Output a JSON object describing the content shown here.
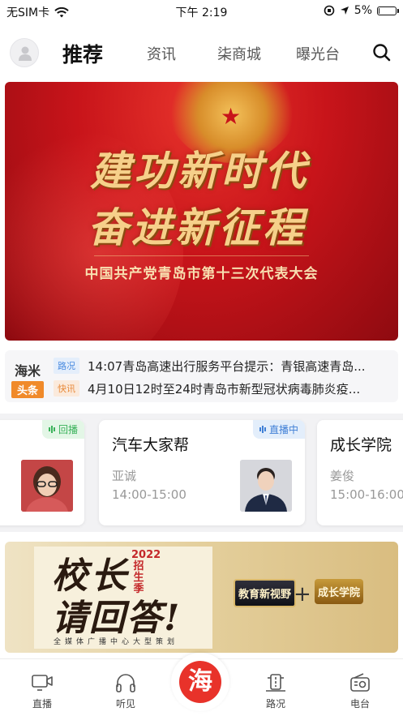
{
  "status_bar": {
    "carrier": "无SIM卡",
    "time": "下午 2:19",
    "battery": "5%",
    "battery_level": 0.05
  },
  "header": {
    "tabs": [
      {
        "label": "推荐",
        "active": true
      },
      {
        "label": "资讯",
        "active": false
      },
      {
        "label": "柒商城",
        "active": false
      },
      {
        "label": "曝光台",
        "active": false
      }
    ],
    "icons": [
      "avatar-icon",
      "search-icon"
    ]
  },
  "banner": {
    "headline_1": "建功新时代",
    "headline_2": "奋进新征程",
    "subtitle": "中国共产党青岛市第十三次代表大会"
  },
  "news": {
    "logo_top": "海米",
    "logo_bottom": "头条",
    "items": [
      {
        "tag": "路况",
        "text": "14:07青岛高速出行服务平台提示：青银高速青岛..."
      },
      {
        "tag": "快讯",
        "text": "4月10日12时至24时青岛市新型冠状病毒肺炎疫..."
      }
    ]
  },
  "programs": [
    {
      "badge": "回播",
      "title": "",
      "host": "",
      "time": ""
    },
    {
      "badge": "直播中",
      "title": "汽车大家帮",
      "host": "亚诚",
      "time": "14:00-15:00"
    },
    {
      "badge": "",
      "title": "成长学院",
      "host": "姜俊",
      "time": "15:00-16:00"
    }
  ],
  "promo": {
    "headline_1": "校长",
    "headline_2": "请回答!",
    "year_label": "2022招生季",
    "footer": "全媒体广播中心大型策划",
    "badge_left": "教育新视野",
    "badge_right": "成长学院",
    "plus": "+"
  },
  "bottom_nav": {
    "items": [
      {
        "label": "直播",
        "icon": "live-video-icon"
      },
      {
        "label": "听见",
        "icon": "headphones-icon"
      },
      {
        "label": "路况",
        "icon": "traffic-icon"
      },
      {
        "label": "电台",
        "icon": "radio-icon"
      }
    ],
    "center": "海"
  },
  "colors": {
    "accent": "#e8322a",
    "tab_underline": "#f2a23a",
    "live_badge": "#3f7fd6",
    "replay_badge": "#3ab25a"
  }
}
